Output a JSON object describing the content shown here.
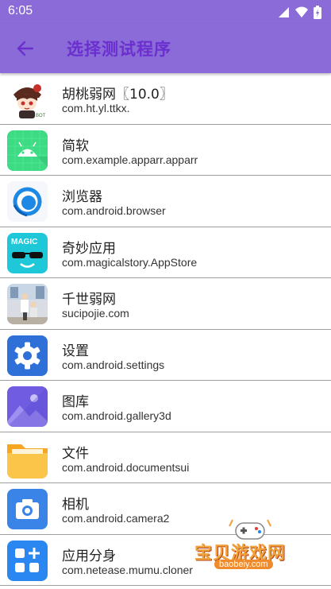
{
  "status_bar": {
    "time": "6:05"
  },
  "app_bar": {
    "title": "选择测试程序"
  },
  "apps": [
    {
      "name": "胡桃弱网〖10.0〗",
      "package": "com.ht.yl.ttkx."
    },
    {
      "name": "简软",
      "package": "com.example.apparr.apparr"
    },
    {
      "name": "浏览器",
      "package": "com.android.browser"
    },
    {
      "name": "奇妙应用",
      "package": "com.magicalstory.AppStore"
    },
    {
      "name": "千世弱网",
      "package": "sucipojie.com"
    },
    {
      "name": "设置",
      "package": "com.android.settings"
    },
    {
      "name": "图库",
      "package": "com.android.gallery3d"
    },
    {
      "name": "文件",
      "package": "com.android.documentsui"
    },
    {
      "name": "相机",
      "package": "com.android.camera2"
    },
    {
      "name": "应用分身",
      "package": "com.netease.mumu.cloner"
    }
  ],
  "icons": {
    "magic_label": "MAGIC",
    "hutao_tag": "BOT"
  },
  "watermark": {
    "title": "宝贝游戏网",
    "url": "baobeiy.com"
  },
  "colors": {
    "app_bar": "#8a6bd8",
    "title": "#6b2fd0",
    "divider": "#9e9e9e"
  }
}
